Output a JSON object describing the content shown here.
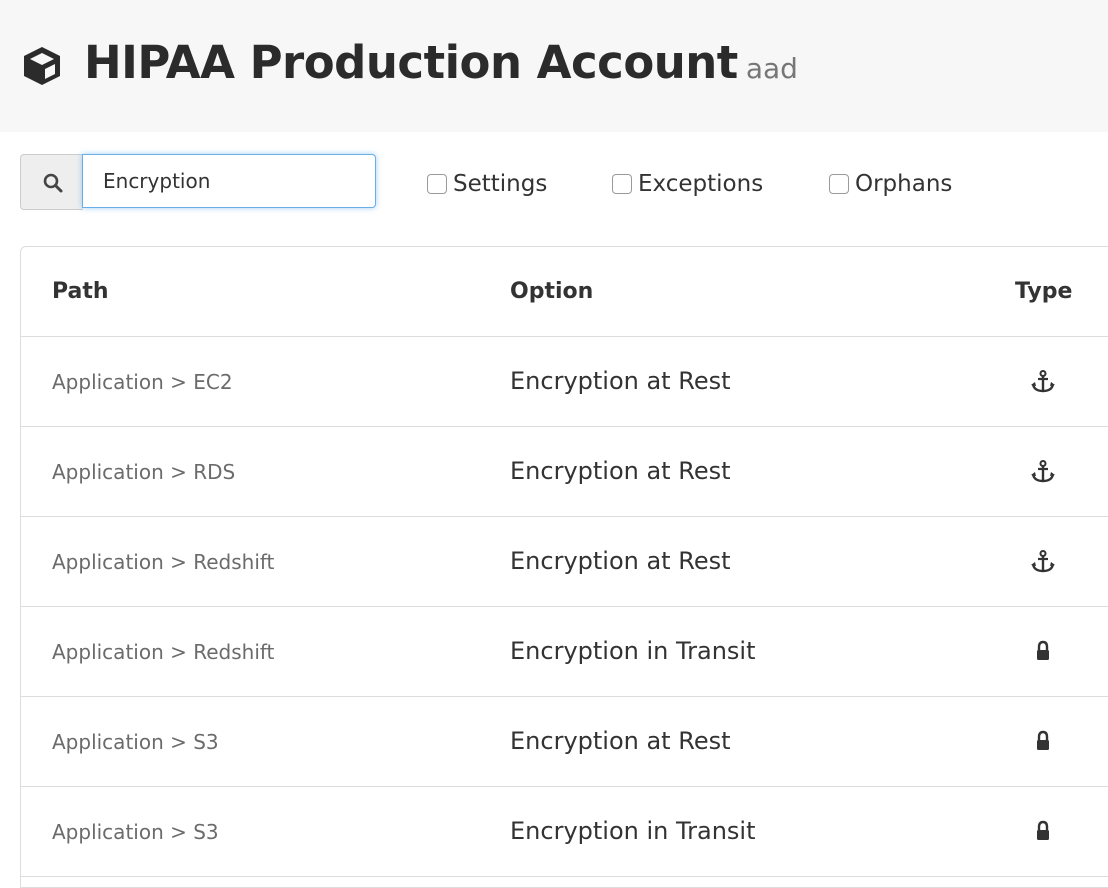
{
  "header": {
    "title": "HIPAA Production Account",
    "subtitle": "aad",
    "icon": "cube-icon"
  },
  "search": {
    "icon": "search-icon",
    "value": "Encryption"
  },
  "filters": [
    {
      "label": "Settings",
      "checked": false
    },
    {
      "label": "Exceptions",
      "checked": false
    },
    {
      "label": "Orphans",
      "checked": false
    }
  ],
  "table": {
    "columns": [
      "Path",
      "Option",
      "Type"
    ],
    "rows": [
      {
        "path": "Application > EC2",
        "option": "Encryption at Rest",
        "type": "anchor-icon"
      },
      {
        "path": "Application > RDS",
        "option": "Encryption at Rest",
        "type": "anchor-icon"
      },
      {
        "path": "Application > Redshift",
        "option": "Encryption at Rest",
        "type": "anchor-icon"
      },
      {
        "path": "Application > Redshift",
        "option": "Encryption in Transit",
        "type": "lock-icon"
      },
      {
        "path": "Application > S3",
        "option": "Encryption at Rest",
        "type": "lock-icon"
      },
      {
        "path": "Application > S3",
        "option": "Encryption in Transit",
        "type": "lock-icon"
      }
    ]
  },
  "colors": {
    "header_bg": "#f7f7f7",
    "focus_border": "#66afe9",
    "border": "#dddddd",
    "text": "#333333",
    "muted_text": "#6b6b6b"
  }
}
